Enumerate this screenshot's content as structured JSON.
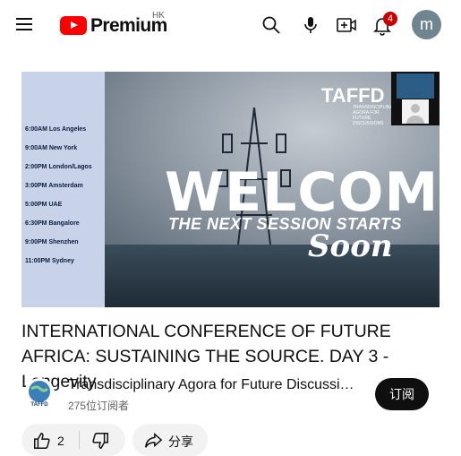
{
  "header": {
    "logo_text": "Premium",
    "region": "HK",
    "notification_count": "4",
    "avatar_letter": "m"
  },
  "video": {
    "schedule": [
      "6:00AM  Los Angeles",
      "9:00AM New York",
      "2:00PM  London/Lagos",
      "3:00PM  Amsterdam",
      "5:00PM  UAE",
      "6:30PM Bangalore",
      "9:00PM Shenzhen",
      "11:00PM  Sydney"
    ],
    "welcome": "WELCOME",
    "next_session": "THE NEXT SESSION STARTS",
    "soon": "Soon",
    "org_logo": "TAFFD",
    "org_sub": "TRANSDISCIPLINARY AGORA FOR FUTURE DISCUSSIONS"
  },
  "title": "INTERNATIONAL CONFERENCE OF FUTURE AFRICA: SUSTAINING THE SOURCE. DAY 3 - Longevity",
  "channel": {
    "name": "Transdisciplinary Agora for Future Discussions",
    "subscribers": "275位订阅者",
    "avatar_text": "TAFFD"
  },
  "subscribe_label": "订阅",
  "actions": {
    "like_count": "2",
    "share_label": "分享"
  },
  "colors": {
    "brand_red": "#ff0000",
    "badge_red": "#cc0000",
    "button_dark": "#0f0f0f"
  }
}
